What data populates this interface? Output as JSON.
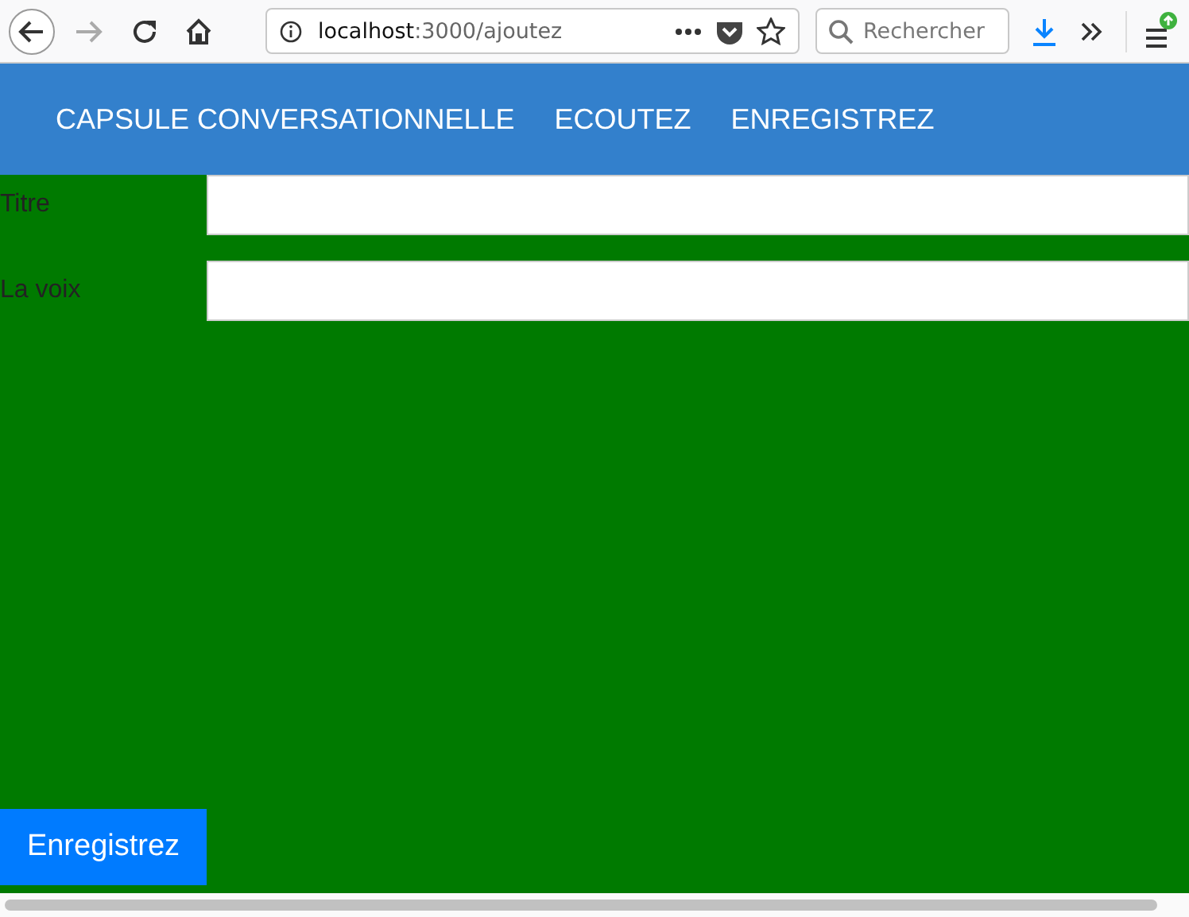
{
  "browser": {
    "url_host": "localhost",
    "url_path": ":3000/ajoutez",
    "search": {
      "placeholder": "Rechercher"
    },
    "forward_disabled": true
  },
  "nav": {
    "items": [
      {
        "label": "CAPSULE CONVERSATIONNELLE"
      },
      {
        "label": "ECOUTEZ"
      },
      {
        "label": "ENREGISTREZ"
      }
    ]
  },
  "form": {
    "fields": [
      {
        "label": "Titre"
      },
      {
        "label": "La voix"
      }
    ],
    "submit": "Enregistrez"
  }
}
